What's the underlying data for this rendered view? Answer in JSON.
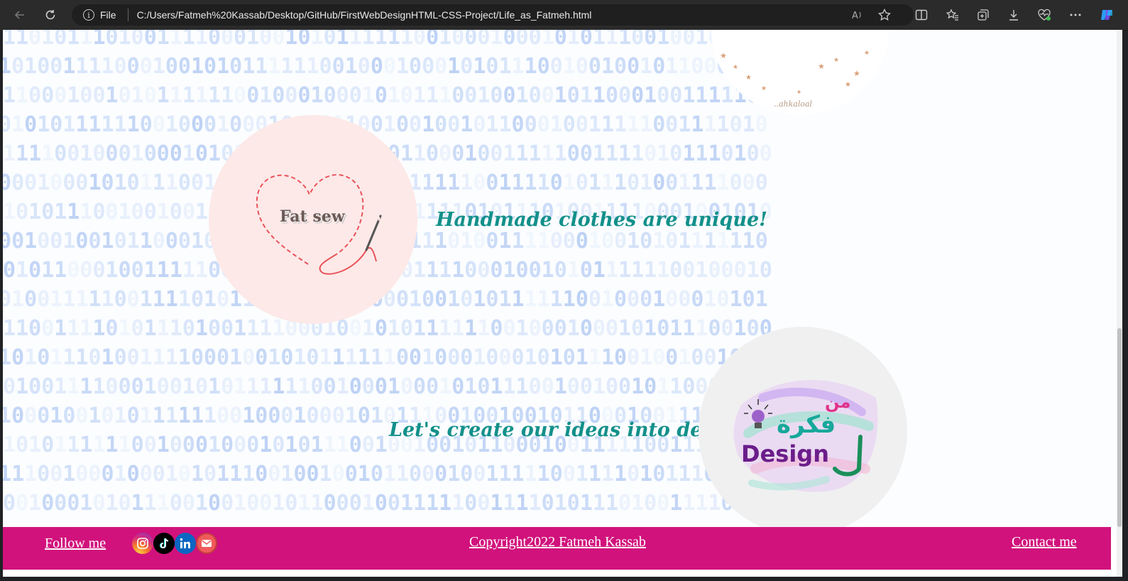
{
  "browser": {
    "scheme_label": "File",
    "url": "C:/Users/Fatmeh%20Kassab/Desktop/GitHub/FirstWebDesignHTML-CSS-Project/Life_as_Fatmeh.html",
    "icons": [
      "back-arrow-icon",
      "refresh-icon",
      "info-icon",
      "read-aloud-icon",
      "favorite-star-icon",
      "split-screen-icon",
      "favorites-icon",
      "collections-icon",
      "downloads-icon",
      "browser-essentials-icon",
      "more-icon",
      "copilot-icon"
    ]
  },
  "page": {
    "binary_text": "1101011101001111000100101011111100100010001010111001001001011000100111110011",
    "background_digit_color": "#2f6fde",
    "fatsew_logo_text": "Fat sew",
    "tagline_handmade": "Handmade clothes are unique!",
    "tagline_ideas": "Let's create our ideas into designs!",
    "design_logo_arabic_top": "من",
    "design_logo_arabic_main": "فكرة",
    "design_logo_arabic_side": "لـ",
    "design_logo_latin": "Design",
    "top_logo_script": "..ahkaloal",
    "accent_color": "#13908a"
  },
  "footer": {
    "follow_label": "Follow me",
    "copyright": "Copyright2022 Fatmeh Kassab",
    "contact_label": "Contact me",
    "social_icons": [
      "instagram-icon",
      "tiktok-icon",
      "linkedin-icon",
      "mail-icon"
    ],
    "background_color": "#d1127c"
  }
}
